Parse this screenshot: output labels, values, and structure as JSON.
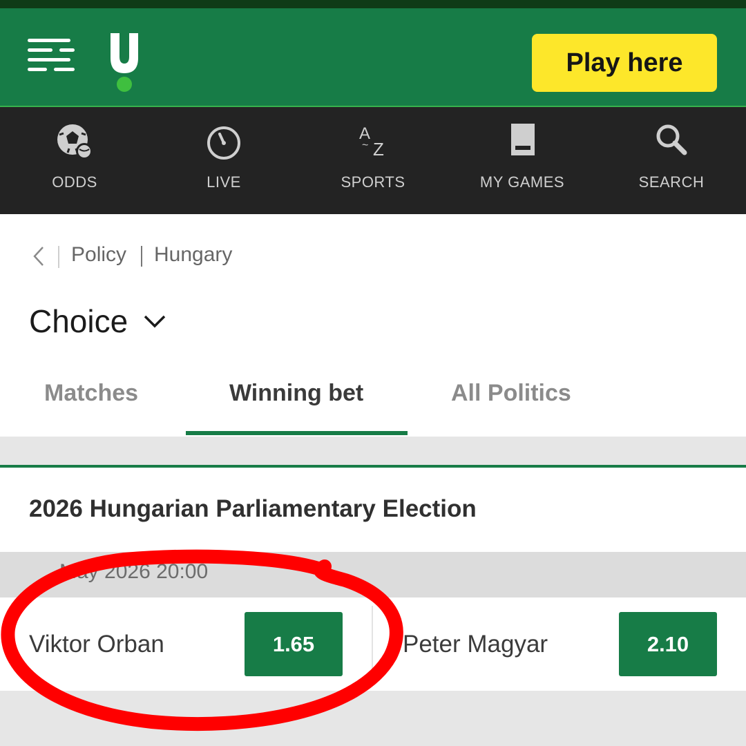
{
  "header": {
    "play_label": "Play here",
    "accent": "#177c47",
    "button_color": "#fde72a"
  },
  "nav": {
    "items": [
      {
        "label": "ODDS",
        "icon": "soccer-ball-icon"
      },
      {
        "label": "LIVE",
        "icon": "stopwatch-icon"
      },
      {
        "label": "SPORTS",
        "icon": "a-z-icon"
      },
      {
        "label": "MY GAMES",
        "icon": "bet-slip-icon"
      },
      {
        "label": "SEARCH",
        "icon": "search-icon"
      }
    ]
  },
  "breadcrumb": {
    "items": [
      "Policy",
      "Hungary"
    ]
  },
  "page": {
    "title": "Choice"
  },
  "tabs": [
    {
      "label": "Matches",
      "active": false
    },
    {
      "label": "Winning bet",
      "active": true
    },
    {
      "label": "All Politics",
      "active": false
    }
  ],
  "event": {
    "title": "2026 Hungarian Parliamentary Election",
    "date": "May 2026 20:00",
    "selections": [
      {
        "name": "Viktor Orban",
        "odds": "1.65"
      },
      {
        "name": "Peter Magyar",
        "odds": "2.10"
      }
    ]
  },
  "annotation": {
    "color": "#ff0000"
  }
}
